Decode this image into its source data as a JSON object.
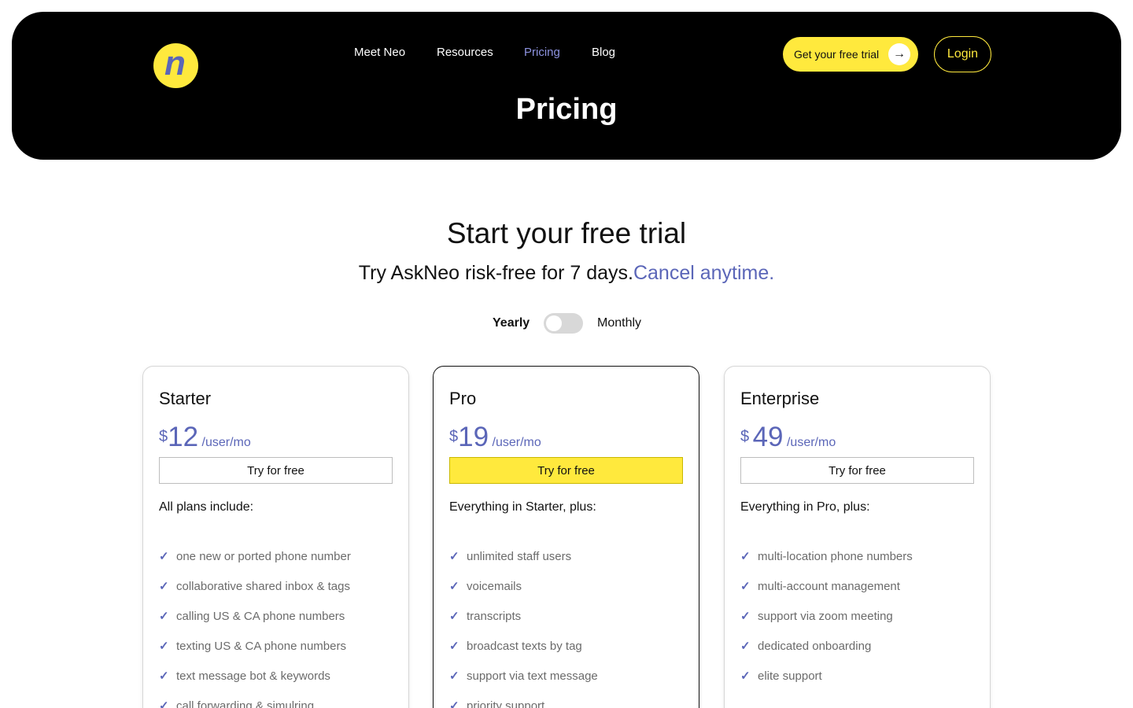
{
  "header": {
    "logo_letter": "n",
    "nav": [
      "Meet Neo",
      "Resources",
      "Pricing",
      "Blog"
    ],
    "trial_button": "Get your free trial",
    "login_button": "Login",
    "title": "Pricing"
  },
  "intro": {
    "title": "Start your free trial",
    "subtitle": "Try AskNeo risk-free for 7 days.",
    "subtitle_accent": "Cancel anytime."
  },
  "billing_toggle": {
    "yearly": "Yearly",
    "monthly": "Monthly",
    "selected": "Yearly"
  },
  "plans": [
    {
      "name": "Starter",
      "currency": "$",
      "price": "12",
      "per": "/user/mo",
      "cta": "Try for free",
      "includes": "All plans include:",
      "features": [
        "one new or ported phone number",
        "collaborative shared inbox & tags",
        "calling US & CA phone numbers",
        "texting US & CA phone numbers",
        "text message bot & keywords",
        "call forwarding & simulring"
      ]
    },
    {
      "name": "Pro",
      "currency": "$",
      "price": "19",
      "per": "/user/mo",
      "cta": "Try for free",
      "includes": "Everything in Starter, plus:",
      "features": [
        "unlimited staff users",
        "voicemails",
        "transcripts",
        "broadcast texts by tag",
        "support via text message",
        "priority support"
      ]
    },
    {
      "name": "Enterprise",
      "currency": "$",
      "price": "49",
      "per": "/user/mo",
      "cta": "Try for free",
      "includes": "Everything in Pro, plus:",
      "features": [
        "multi-location phone numbers",
        "multi-account management",
        "support via zoom meeting",
        "dedicated onboarding",
        "elite support"
      ]
    }
  ],
  "colors": {
    "accent": "#5b66b8",
    "brand_yellow": "#ffe93d",
    "nav_active": "#8d93e0"
  },
  "icons": {
    "trial_arrow": "arrow-right-icon",
    "feature_check": "check-icon"
  }
}
